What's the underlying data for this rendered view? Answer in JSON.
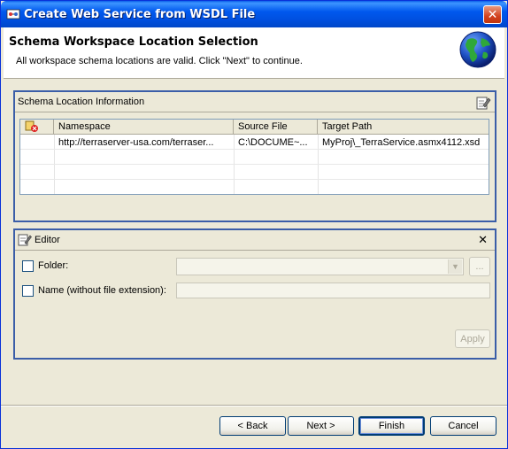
{
  "window": {
    "title": "Create Web Service from WSDL File",
    "close_glyph": "✕"
  },
  "banner": {
    "title": "Schema Workspace Location Selection",
    "description": "All workspace schema locations are valid. Click \"Next\" to continue.",
    "icon": "globe-icon"
  },
  "schema_group": {
    "label": "Schema Location Information",
    "columns": [
      "",
      "Namespace",
      "Source File",
      "Target Path"
    ],
    "rows": [
      {
        "namespace": "http://terraserver-usa.com/terraser...",
        "source_file": "C:\\DOCUME~...",
        "target_path": "MyProj\\_TerraService.asmx4112.xsd"
      }
    ]
  },
  "editor": {
    "label": "Editor",
    "close_glyph": "✕",
    "folder_label": "Folder:",
    "folder_value": "",
    "browse_label": "...",
    "name_label": "Name (without file extension):",
    "name_value": "",
    "apply_label": "Apply"
  },
  "buttons": {
    "back": "< Back",
    "next": "Next >",
    "finish": "Finish",
    "cancel": "Cancel"
  },
  "colors": {
    "titlebar": "#0058ee",
    "group_border": "#3b5ea8",
    "dialog_bg": "#ece9d8"
  }
}
